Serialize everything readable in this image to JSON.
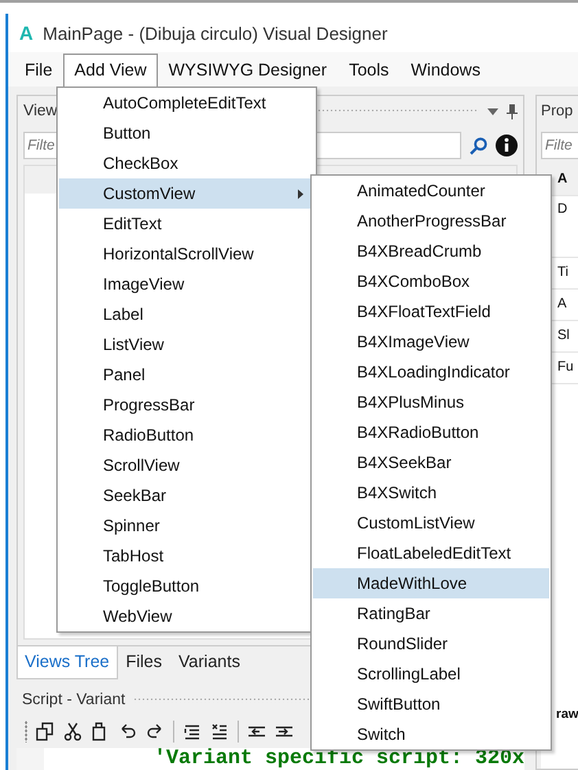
{
  "window": {
    "logo": "A",
    "title": "MainPage - (Dibuja circulo) Visual Designer"
  },
  "menu_bar": [
    {
      "label": "File",
      "selected": false
    },
    {
      "label": "Add View",
      "selected": true
    },
    {
      "label": "WYSIWYG Designer",
      "selected": false
    },
    {
      "label": "Tools",
      "selected": false
    },
    {
      "label": "Windows",
      "selected": false
    }
  ],
  "views_panel": {
    "title": "View",
    "filter_placeholder": "Filte"
  },
  "properties_panel": {
    "title": "Prop",
    "filter_placeholder": "Filte",
    "rows": [
      {
        "kind": "category",
        "text": "A"
      },
      {
        "kind": "description",
        "text": "D"
      },
      {
        "kind": "property",
        "text": "Ti"
      },
      {
        "kind": "property",
        "text": "A"
      },
      {
        "kind": "property",
        "text": "Sl"
      },
      {
        "kind": "property",
        "text": "Fu"
      }
    ],
    "bottom_row": {
      "kind": "category",
      "text": "raw"
    }
  },
  "bottom_tabs": [
    {
      "label": "Views Tree",
      "selected": true
    },
    {
      "label": "Files",
      "selected": false
    },
    {
      "label": "Variants",
      "selected": false
    }
  ],
  "script_panel": {
    "title": "Script - Variant",
    "code": "'Variant specific script: 320x"
  },
  "add_view_menu": [
    {
      "label": "AutoCompleteEditText",
      "selected": false,
      "submenu": false
    },
    {
      "label": "Button",
      "selected": false,
      "submenu": false
    },
    {
      "label": "CheckBox",
      "selected": false,
      "submenu": false
    },
    {
      "label": "CustomView",
      "selected": true,
      "submenu": true
    },
    {
      "label": "EditText",
      "selected": false,
      "submenu": false
    },
    {
      "label": "HorizontalScrollView",
      "selected": false,
      "submenu": false
    },
    {
      "label": "ImageView",
      "selected": false,
      "submenu": false
    },
    {
      "label": "Label",
      "selected": false,
      "submenu": false
    },
    {
      "label": "ListView",
      "selected": false,
      "submenu": false
    },
    {
      "label": "Panel",
      "selected": false,
      "submenu": false
    },
    {
      "label": "ProgressBar",
      "selected": false,
      "submenu": false
    },
    {
      "label": "RadioButton",
      "selected": false,
      "submenu": false
    },
    {
      "label": "ScrollView",
      "selected": false,
      "submenu": false
    },
    {
      "label": "SeekBar",
      "selected": false,
      "submenu": false
    },
    {
      "label": "Spinner",
      "selected": false,
      "submenu": false
    },
    {
      "label": "TabHost",
      "selected": false,
      "submenu": false
    },
    {
      "label": "ToggleButton",
      "selected": false,
      "submenu": false
    },
    {
      "label": "WebView",
      "selected": false,
      "submenu": false
    }
  ],
  "custom_view_submenu": [
    {
      "label": "AnimatedCounter",
      "selected": false
    },
    {
      "label": "AnotherProgressBar",
      "selected": false
    },
    {
      "label": "B4XBreadCrumb",
      "selected": false
    },
    {
      "label": "B4XComboBox",
      "selected": false
    },
    {
      "label": "B4XFloatTextField",
      "selected": false
    },
    {
      "label": "B4XImageView",
      "selected": false
    },
    {
      "label": "B4XLoadingIndicator",
      "selected": false
    },
    {
      "label": "B4XPlusMinus",
      "selected": false
    },
    {
      "label": "B4XRadioButton",
      "selected": false
    },
    {
      "label": "B4XSeekBar",
      "selected": false
    },
    {
      "label": "B4XSwitch",
      "selected": false
    },
    {
      "label": "CustomListView",
      "selected": false
    },
    {
      "label": "FloatLabeledEditText",
      "selected": false
    },
    {
      "label": "MadeWithLove",
      "selected": true
    },
    {
      "label": "RatingBar",
      "selected": false
    },
    {
      "label": "RoundSlider",
      "selected": false
    },
    {
      "label": "ScrollingLabel",
      "selected": false
    },
    {
      "label": "SwiftButton",
      "selected": false
    },
    {
      "label": "Switch",
      "selected": false
    }
  ]
}
